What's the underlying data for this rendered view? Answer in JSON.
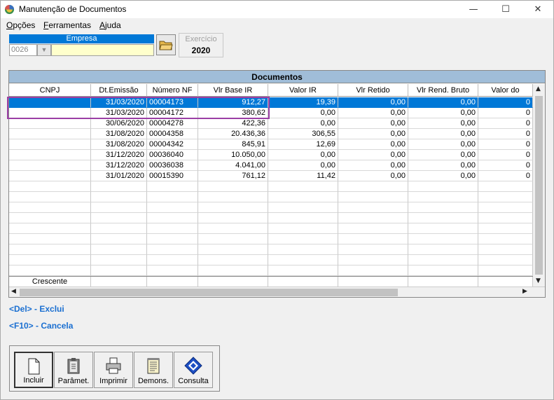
{
  "window": {
    "title": "Manutenção de Documentos",
    "controls": {
      "minimize": "—",
      "maximize": "☐",
      "close": "✕"
    }
  },
  "menu": [
    {
      "label": "Opções",
      "mnemonic": "O"
    },
    {
      "label": "Ferramentas",
      "mnemonic": "F"
    },
    {
      "label": "Ajuda",
      "mnemonic": "A"
    }
  ],
  "empresa": {
    "label": "Empresa",
    "code": "0026",
    "name": ""
  },
  "exercicio": {
    "label": "Exercício",
    "value": "2020"
  },
  "grid": {
    "title": "Documentos",
    "columns": [
      "CNPJ",
      "Dt.Emissão",
      "Número NF",
      "Vlr Base IR",
      "Valor IR",
      "Vlr Retido",
      "Vlr Rend. Bruto",
      "Valor do"
    ],
    "rows": [
      {
        "cnpj": "",
        "data": "31/03/2020",
        "nf": "00004173",
        "base": "912,27",
        "ir": "19,39",
        "retido": "0,00",
        "bruto": "0,00",
        "valor": "0",
        "selected": true
      },
      {
        "cnpj": "",
        "data": "31/03/2020",
        "nf": "00004172",
        "base": "380,62",
        "ir": "0,00",
        "retido": "0,00",
        "bruto": "0,00",
        "valor": "0",
        "selected": false
      },
      {
        "cnpj": "",
        "data": "30/06/2020",
        "nf": "00004278",
        "base": "422,36",
        "ir": "0,00",
        "retido": "0,00",
        "bruto": "0,00",
        "valor": "0",
        "selected": false
      },
      {
        "cnpj": "",
        "data": "31/08/2020",
        "nf": "00004358",
        "base": "20.436,36",
        "ir": "306,55",
        "retido": "0,00",
        "bruto": "0,00",
        "valor": "0",
        "selected": false
      },
      {
        "cnpj": "",
        "data": "31/08/2020",
        "nf": "00004342",
        "base": "845,91",
        "ir": "12,69",
        "retido": "0,00",
        "bruto": "0,00",
        "valor": "0",
        "selected": false
      },
      {
        "cnpj": "",
        "data": "31/12/2020",
        "nf": "00036040",
        "base": "10.050,00",
        "ir": "0,00",
        "retido": "0,00",
        "bruto": "0,00",
        "valor": "0",
        "selected": false
      },
      {
        "cnpj": "",
        "data": "31/12/2020",
        "nf": "00036038",
        "base": "4.041,00",
        "ir": "0,00",
        "retido": "0,00",
        "bruto": "0,00",
        "valor": "0",
        "selected": false
      },
      {
        "cnpj": "",
        "data": "31/01/2020",
        "nf": "00015390",
        "base": "761,12",
        "ir": "11,42",
        "retido": "0,00",
        "bruto": "0,00",
        "valor": "0",
        "selected": false
      }
    ],
    "footer": "Crescente"
  },
  "hints": {
    "del": "<Del> - Exclui",
    "f10": "<F10> - Cancela"
  },
  "toolbar": [
    {
      "label": "Incluir",
      "icon": "document-icon"
    },
    {
      "label": "Parâmet.",
      "icon": "clipboard-icon"
    },
    {
      "label": "Imprimir",
      "icon": "printer-icon"
    },
    {
      "label": "Demons.",
      "icon": "notepad-icon"
    },
    {
      "label": "Consulta",
      "icon": "diamond-icon"
    }
  ],
  "colors": {
    "selection": "#0078d7",
    "grid_title": "#a0bdd8",
    "hint_text": "#1a6fd1",
    "highlight_border": "#9b3fa5",
    "empresa_name_bg": "#ffffcc"
  }
}
